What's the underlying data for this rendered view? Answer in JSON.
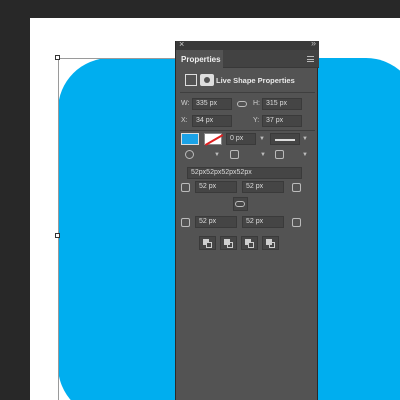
{
  "panel": {
    "tab_label": "Properties",
    "header_title": "Live Shape Properties",
    "size": {
      "w_label": "W:",
      "w_value": "335 px",
      "h_label": "H:",
      "h_value": "315 px"
    },
    "position": {
      "x_label": "X:",
      "x_value": "34 px",
      "y_label": "Y:",
      "y_value": "37 px"
    },
    "stroke": {
      "width_value": "0 px"
    },
    "corners": {
      "combined_value": "52px52px52px52px",
      "top_left": "52 px",
      "top_right": "52 px",
      "bottom_left": "52 px",
      "bottom_right": "52 px"
    }
  },
  "colors": {
    "shape_fill": "#00aeef",
    "panel_bg": "#535353",
    "workspace_bg": "#282828"
  },
  "icons": [
    "close-icon",
    "collapse-icon",
    "panel-menu-icon",
    "transform-icon",
    "mask-icon",
    "link-icon",
    "corner-icon",
    "pathfinder-icon"
  ]
}
